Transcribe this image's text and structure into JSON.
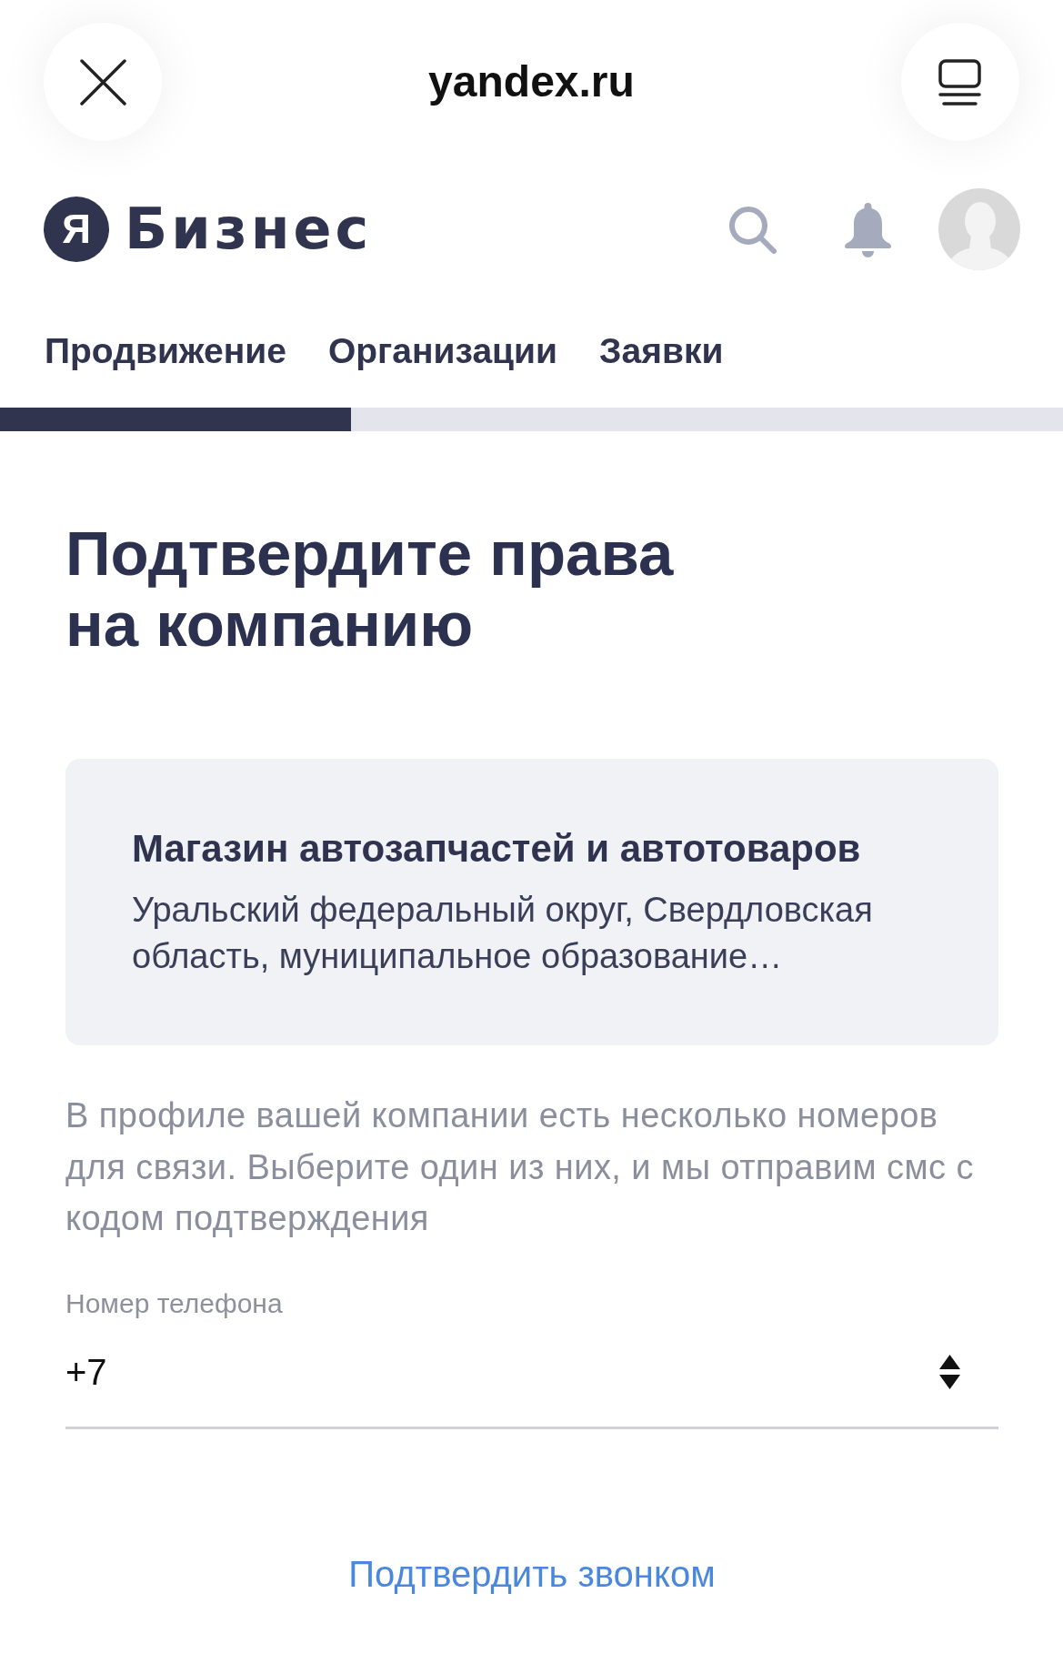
{
  "browser_bar": {
    "url": "yandex.ru"
  },
  "header": {
    "logo_letter": "Я",
    "logo_text": "Бизнес"
  },
  "tabs": [
    {
      "label": "Продвижение"
    },
    {
      "label": "Организации"
    },
    {
      "label": "Заявки"
    }
  ],
  "progress": {
    "level": 0.33
  },
  "title": "Подтвердите права на компанию",
  "company": {
    "name": "Магазин автозапчастей и автотоваров",
    "address": "Уральский федеральный округ, Свердловская область, муниципальное образование…"
  },
  "description": "В профиле вашей компании есть несколько номеров для связи. Выберите один из них, и мы отправим смс с кодом подтверждения",
  "phone_field": {
    "label": "Номер телефона",
    "value": "+7"
  },
  "link": "Подтвердить звонком"
}
